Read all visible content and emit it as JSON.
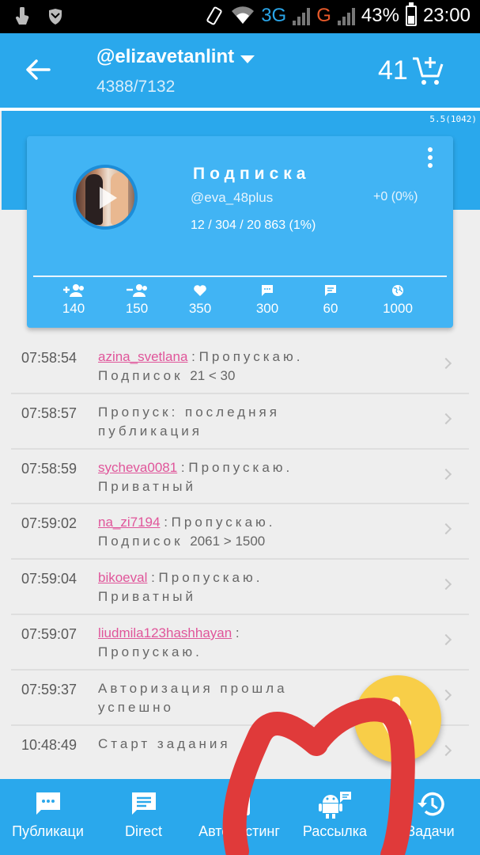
{
  "status_bar": {
    "network_3g": "3G",
    "network_g": "G",
    "battery": "43%",
    "time": "23:00"
  },
  "app_bar": {
    "account": "@elizavetanlint",
    "progress": "4388/7132",
    "credits": "41",
    "version": "5.5(1042)"
  },
  "card": {
    "title": "Подписка",
    "username": "@eva_48plus",
    "delta": "+0 (0%)",
    "stats": "12 / 304 / 20 863 (1%)",
    "counters": [
      {
        "icon": "follow-icon",
        "value": "140"
      },
      {
        "icon": "unfollow-icon",
        "value": "150"
      },
      {
        "icon": "heart-icon",
        "value": "350"
      },
      {
        "icon": "comment-icon",
        "value": "300"
      },
      {
        "icon": "message-icon",
        "value": "60"
      },
      {
        "icon": "globe-icon",
        "value": "1000"
      }
    ]
  },
  "log": [
    {
      "time": "07:58:54",
      "user": "azina_svetlana",
      "text": "Пропускаю.",
      "line2": "Подписок",
      "nums": "21 < 30"
    },
    {
      "time": "07:58:57",
      "user": "",
      "text": "Пропуск: последняя",
      "line2": "публикация",
      "nums": ""
    },
    {
      "time": "07:58:59",
      "user": "sycheva0081",
      "text": "Пропускаю.",
      "line2": "Приватный",
      "nums": ""
    },
    {
      "time": "07:59:02",
      "user": "na_zi7194",
      "text": "Пропускаю.",
      "line2": "Подписок",
      "nums": "2061 > 1500"
    },
    {
      "time": "07:59:04",
      "user": "bikoeval",
      "text": "Пропускаю.",
      "line2": "Приватный",
      "nums": ""
    },
    {
      "time": "07:59:07",
      "user": "liudmila123hashhayan",
      "text": "",
      "line2": "Пропускаю.",
      "nums": ""
    },
    {
      "time": "07:59:37",
      "user": "",
      "text": "Авторизация прошла",
      "line2": "успешно",
      "nums": ""
    },
    {
      "time": "10:48:49",
      "user": "",
      "text": "Старт задания",
      "line2": "",
      "nums": ""
    }
  ],
  "bottom_nav": [
    {
      "icon": "publications-icon",
      "label": "Публикаци"
    },
    {
      "icon": "direct-icon",
      "label": "Direct"
    },
    {
      "icon": "autoposting-icon",
      "label": "Автопостинг"
    },
    {
      "icon": "mailing-icon",
      "label": "Рассылка"
    },
    {
      "icon": "history-icon",
      "label": "Задачи"
    }
  ],
  "colors": {
    "primary": "#2aa8ec",
    "card": "#41b4f4",
    "username_link": "#e0559a",
    "fab": "#f8ce48",
    "annotation": "#e03a3a"
  }
}
